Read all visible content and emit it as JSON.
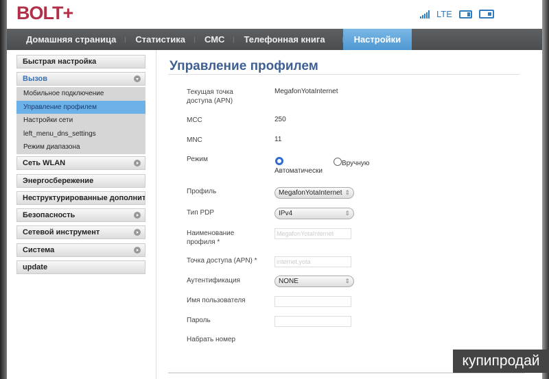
{
  "header": {
    "logo": "BOLT+",
    "network": "LTE"
  },
  "nav": [
    "Домашняя страница",
    "Статистика",
    "СМС",
    "Телефонная книга",
    "Настройки"
  ],
  "sidebar": {
    "items": [
      "Быстрая настройка",
      "Вызов",
      "Сеть WLAN",
      "Энергосбережение",
      "Неструктурированные дополните",
      "Безопасность",
      "Сетевой инструмент",
      "Система",
      "update"
    ],
    "subitems": [
      "Мобильное подключение",
      "Управление профилем",
      "Настройки сети",
      "left_menu_dns_settings",
      "Режим диапазона"
    ]
  },
  "main": {
    "title": "Управление профилем",
    "apn_label": "Текущая точка доступа (APN)",
    "apn_value": "MegafonYotaInternet",
    "mcc_label": "MCC",
    "mcc_value": "250",
    "mnc_label": "MNC",
    "mnc_value": "11",
    "mode_label": "Режим",
    "mode_auto": "Автоматически",
    "mode_manual": "Вручную",
    "profile_label": "Профиль",
    "profile_value": "MegafonYotaInternet",
    "pdp_label": "Тип PDP",
    "pdp_value": "IPv4",
    "name_label": "Наименование профиля *",
    "name_value": "MegafonYotaInternet",
    "apn2_label": "Точка доступа (APN) *",
    "apn2_value": "internet.yota",
    "auth_label": "Аутентификация",
    "auth_value": "NONE",
    "user_label": "Имя пользователя",
    "pass_label": "Пароль",
    "dial_label": "Набрать номер"
  },
  "watermark": "купипродай"
}
